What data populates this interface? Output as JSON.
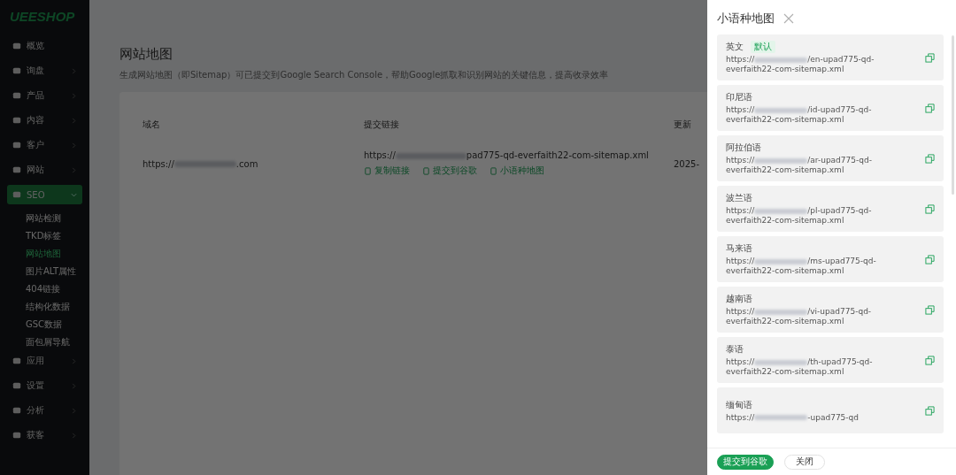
{
  "logo": "UEESHOP",
  "sidebar": {
    "items": [
      {
        "label": "概览",
        "selected": false
      },
      {
        "label": "询盘",
        "expanded": false,
        "selected": false
      },
      {
        "label": "产品",
        "expanded": false,
        "selected": false
      },
      {
        "label": "内容",
        "expanded": false,
        "selected": false
      },
      {
        "label": "客户",
        "expanded": false,
        "selected": false
      },
      {
        "label": "网站",
        "expanded": false,
        "selected": false
      },
      {
        "label": "SEO",
        "expanded": true,
        "selected": true,
        "children": [
          {
            "label": "网站检测",
            "selected": false
          },
          {
            "label": "TKD标签",
            "selected": false
          },
          {
            "label": "网站地图",
            "selected": true
          },
          {
            "label": "图片ALT属性",
            "selected": false
          },
          {
            "label": "404链接",
            "selected": false
          },
          {
            "label": "结构化数据",
            "selected": false
          },
          {
            "label": "GSC数据",
            "selected": false
          },
          {
            "label": "面包屑导航",
            "selected": false
          }
        ]
      },
      {
        "label": "应用",
        "expanded": false,
        "selected": false
      },
      {
        "label": "设置",
        "expanded": false,
        "selected": false
      },
      {
        "label": "分析",
        "expanded": false,
        "selected": false
      },
      {
        "label": "获客",
        "expanded": false,
        "selected": false
      }
    ]
  },
  "page": {
    "title": "网站地图",
    "description": "生成网站地图（即Sitemap）可已提交到Google Search Console，帮助Google抓取和识别网站的关键信息，提高收录效率",
    "table": {
      "columns": [
        "域名",
        "提交链接",
        "更新"
      ],
      "rows": [
        {
          "domain_start": "https://",
          "domain_end": ".com",
          "link_start": "https://",
          "link_end": "pad775-qd-everfaith22-com-sitemap.xml",
          "actions": [
            "复制链接",
            "提交到谷歌",
            "小语种地图"
          ],
          "date": "2025-"
        }
      ]
    }
  },
  "drawer": {
    "title": "小语种地图",
    "items": [
      {
        "language": "英文",
        "badge": "默认",
        "url_start": "https://",
        "url_end": "/en-upad775-qd-everfaith22-com-sitemap.xml"
      },
      {
        "language": "印尼语",
        "url_start": "https://",
        "url_end": "/id-upad775-qd-everfaith22-com-sitemap.xml"
      },
      {
        "language": "阿拉伯语",
        "url_start": "https://",
        "url_end": "/ar-upad775-qd-everfaith22-com-sitemap.xml"
      },
      {
        "language": "波兰语",
        "url_start": "https://",
        "url_end": "/pl-upad775-qd-everfaith22-com-sitemap.xml"
      },
      {
        "language": "马来语",
        "url_start": "https://",
        "url_end": "/ms-upad775-qd-everfaith22-com-sitemap.xml"
      },
      {
        "language": "越南语",
        "url_start": "https://",
        "url_end": "/vi-upad775-qd-everfaith22-com-sitemap.xml"
      },
      {
        "language": "泰语",
        "url_start": "https://",
        "url_end": "/th-upad775-qd-everfaith22-com-sitemap.xml"
      },
      {
        "language": "缅甸语",
        "url_start": "https://",
        "url_end": "-upad775-qd"
      }
    ],
    "buttons": [
      "提交到谷歌",
      "关闭"
    ]
  }
}
